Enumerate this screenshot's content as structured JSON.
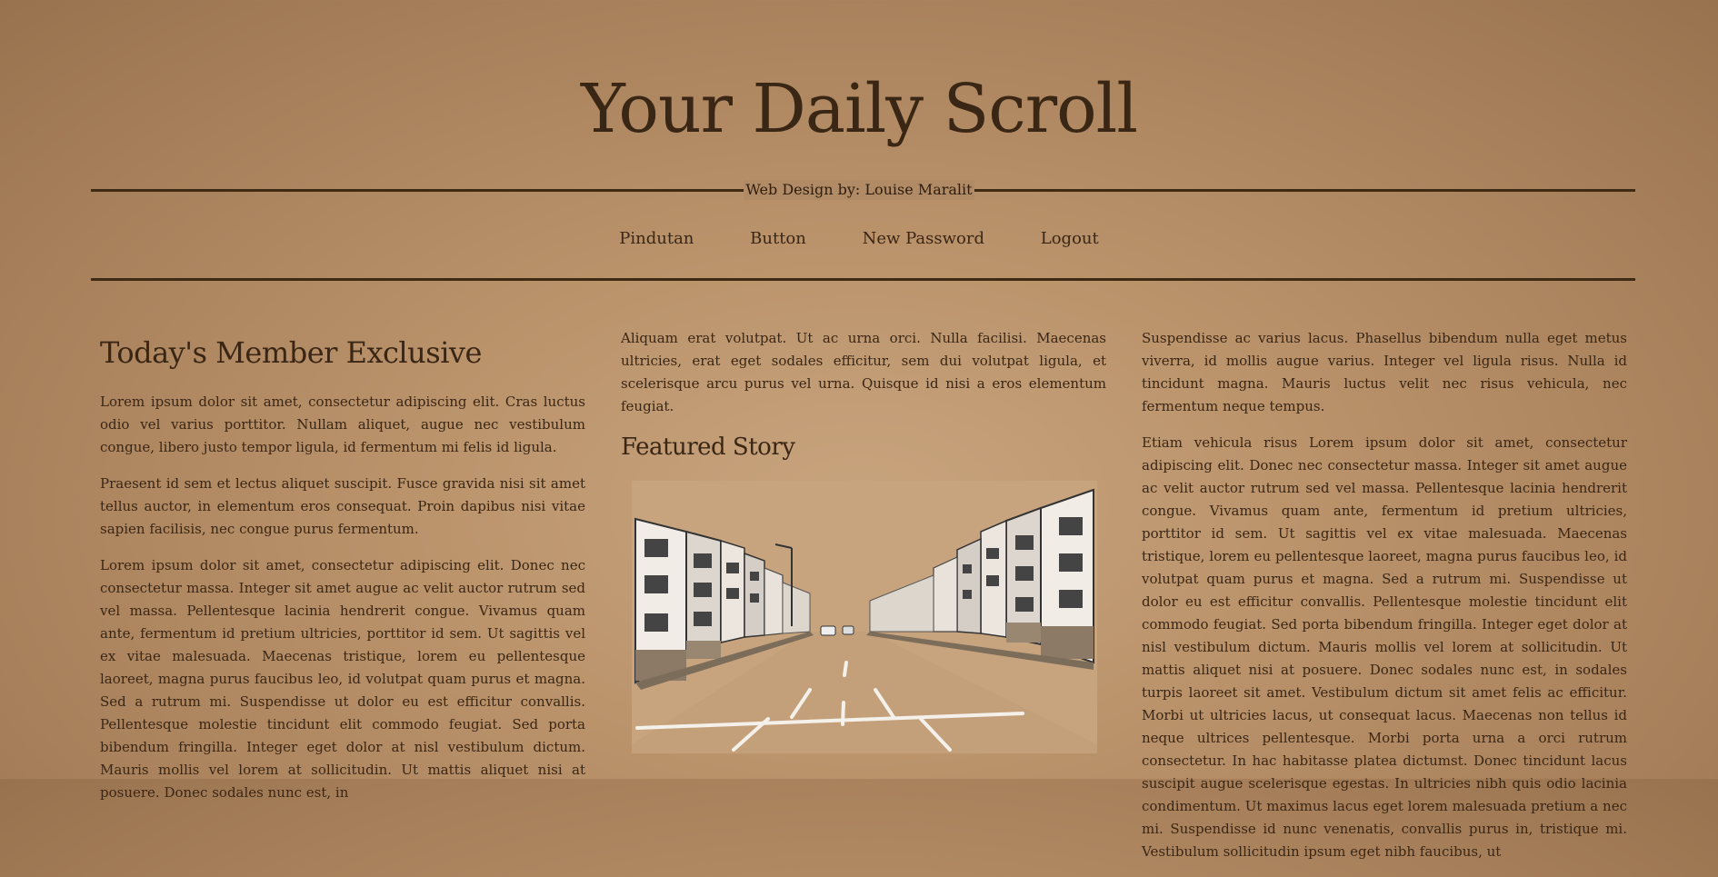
{
  "header": {
    "title": "Your Daily Scroll",
    "credit": "Web Design by: Louise Maralit"
  },
  "nav": {
    "items": [
      "Pindutan",
      "Button",
      "New Password",
      "Logout"
    ]
  },
  "columns": {
    "left": {
      "heading": "Today's Member Exclusive",
      "paragraphs": [
        "Lorem ipsum dolor sit amet, consectetur adipiscing elit. Cras luctus odio vel varius porttitor. Nullam aliquet, augue nec vestibulum congue, libero justo tempor ligula, id fermentum mi felis id ligula.",
        "Praesent id sem et lectus aliquet suscipit. Fusce gravida nisi sit amet tellus auctor, in elementum eros consequat. Proin dapibus nisi vitae sapien facilisis, nec congue purus fermentum.",
        "Lorem ipsum dolor sit amet, consectetur adipiscing elit. Donec nec consectetur massa. Integer sit amet augue ac velit auctor rutrum sed vel massa. Pellentesque lacinia hendrerit congue. Vivamus quam ante, fermentum id pretium ultricies, porttitor id sem. Ut sagittis vel ex vitae malesuada. Maecenas tristique, lorem eu pellentesque laoreet, magna purus faucibus leo, id volutpat quam purus et magna. Sed a rutrum mi. Suspendisse ut dolor eu est efficitur convallis. Pellentesque molestie tincidunt elit commodo feugiat. Sed porta bibendum fringilla. Integer eget dolor at nisl vestibulum dictum. Mauris mollis vel lorem at sollicitudin. Ut mattis aliquet nisi at posuere. Donec sodales nunc est, in"
      ]
    },
    "middle": {
      "intro": "Aliquam erat volutpat. Ut ac urna orci. Nulla facilisi. Maecenas ultricies, erat eget sodales efficitur, sem dui volutpat ligula, et scelerisque arcu purus vel urna. Quisque id nisi a eros elementum feugiat.",
      "heading": "Featured Story",
      "image": "street-illustration"
    },
    "right": {
      "paragraphs": [
        "Suspendisse ac varius lacus. Phasellus bibendum nulla eget metus viverra, id mollis augue varius. Integer vel ligula risus. Nulla id tincidunt magna. Mauris luctus velit nec risus vehicula, nec fermentum neque tempus.",
        "Etiam vehicula risus Lorem ipsum dolor sit amet, consectetur adipiscing elit. Donec nec consectetur massa. Integer sit amet augue ac velit auctor rutrum sed vel massa. Pellentesque lacinia hendrerit congue. Vivamus quam ante, fermentum id pretium ultricies, porttitor id sem. Ut sagittis vel ex vitae malesuada. Maecenas tristique, lorem eu pellentesque laoreet, magna purus faucibus leo, id volutpat quam purus et magna. Sed a rutrum mi. Suspendisse ut dolor eu est efficitur convallis. Pellentesque molestie tincidunt elit commodo feugiat. Sed porta bibendum fringilla. Integer eget dolor at nisl vestibulum dictum. Mauris mollis vel lorem at sollicitudin. Ut mattis aliquet nisi at posuere. Donec sodales nunc est, in sodales turpis laoreet sit amet. Vestibulum dictum sit amet felis ac efficitur. Morbi ut ultricies lacus, ut consequat lacus. Maecenas non tellus id neque ultrices pellentesque. Morbi porta urna a orci rutrum consectetur. In hac habitasse platea dictumst. Donec tincidunt lacus suscipit augue scelerisque egestas. In ultricies nibh quis odio lacinia condimentum. Ut maximus lacus eget lorem malesuada pretium a nec mi. Suspendisse id nunc venenatis, convallis purus in, tristique mi. Vestibulum sollicitudin ipsum eget nibh faucibus, ut"
      ]
    }
  },
  "colors": {
    "ink": "#3a2614",
    "rule": "#3f2a14",
    "parchment": "#bb946c"
  }
}
